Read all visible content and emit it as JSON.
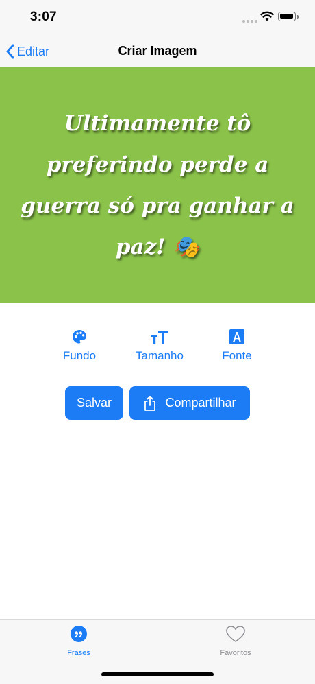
{
  "status_bar": {
    "time": "3:07"
  },
  "nav": {
    "back_label": "Editar",
    "title": "Criar Imagem"
  },
  "canvas": {
    "background_color": "#8bc34a",
    "quote_text": "Ultimamente tô preferindo perde a guerra só pra ganhar a paz! 🎭"
  },
  "tools": [
    {
      "label": "Fundo",
      "icon": "palette-icon"
    },
    {
      "label": "Tamanho",
      "icon": "text-size-icon"
    },
    {
      "label": "Fonte",
      "icon": "font-icon"
    }
  ],
  "actions": {
    "save_label": "Salvar",
    "share_label": "Compartilhar"
  },
  "tab_bar": {
    "items": [
      {
        "label": "Frases",
        "icon": "quote-bubble-icon",
        "active": true
      },
      {
        "label": "Favoritos",
        "icon": "heart-icon",
        "active": false
      }
    ]
  },
  "colors": {
    "accent": "#1b7cf5",
    "inactive": "#8e8e93"
  }
}
